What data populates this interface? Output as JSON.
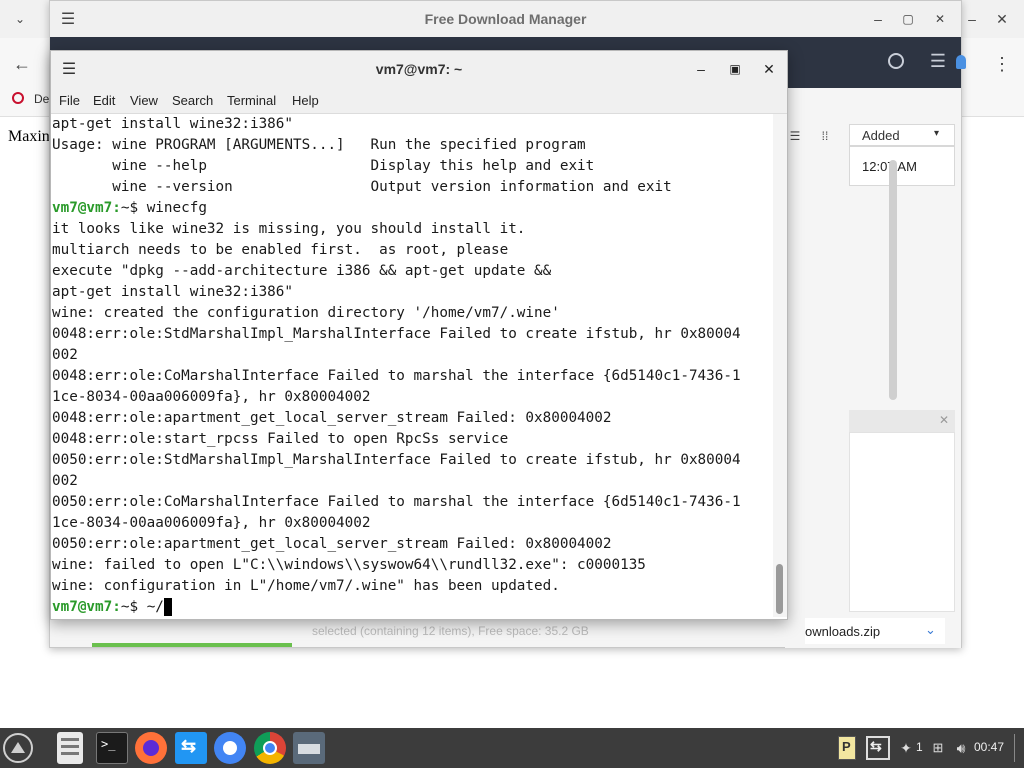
{
  "browser": {
    "bookmark_label": "De",
    "page_text": "Maxin",
    "window_controls": {
      "minimize": "–",
      "maximize": "▫",
      "close": "✕"
    }
  },
  "fdm": {
    "title": "Free Download Manager",
    "column_added": "Added",
    "row_time": "12:07 AM",
    "status_text": "selected (containing 12 items), Free space: 35.2 GB",
    "download_file": "ownloads.zip"
  },
  "terminal": {
    "title": "vm7@vm7: ~",
    "menu": [
      "File",
      "Edit",
      "View",
      "Search",
      "Terminal",
      "Help"
    ],
    "lines": [
      {
        "text": "apt-get install wine32:i386\""
      },
      {
        "text": "Usage: wine PROGRAM [ARGUMENTS...]   Run the specified program"
      },
      {
        "text": "       wine --help                   Display this help and exit"
      },
      {
        "text": "       wine --version                Output version information and exit"
      },
      {
        "prompt": "vm7@vm7:",
        "text": "~$ winecfg"
      },
      {
        "text": "it looks like wine32 is missing, you should install it."
      },
      {
        "text": "multiarch needs to be enabled first.  as root, please"
      },
      {
        "text": "execute \"dpkg --add-architecture i386 && apt-get update &&"
      },
      {
        "text": "apt-get install wine32:i386\""
      },
      {
        "text": "wine: created the configuration directory '/home/vm7/.wine'"
      },
      {
        "text": "0048:err:ole:StdMarshalImpl_MarshalInterface Failed to create ifstub, hr 0x80004"
      },
      {
        "text": "002"
      },
      {
        "text": "0048:err:ole:CoMarshalInterface Failed to marshal the interface {6d5140c1-7436-1"
      },
      {
        "text": "1ce-8034-00aa006009fa}, hr 0x80004002"
      },
      {
        "text": "0048:err:ole:apartment_get_local_server_stream Failed: 0x80004002"
      },
      {
        "text": "0048:err:ole:start_rpcss Failed to open RpcSs service"
      },
      {
        "text": "0050:err:ole:StdMarshalImpl_MarshalInterface Failed to create ifstub, hr 0x80004"
      },
      {
        "text": "002"
      },
      {
        "text": "0050:err:ole:CoMarshalInterface Failed to marshal the interface {6d5140c1-7436-1"
      },
      {
        "text": "1ce-8034-00aa006009fa}, hr 0x80004002"
      },
      {
        "text": "0050:err:ole:apartment_get_local_server_stream Failed: 0x80004002"
      },
      {
        "text": "wine: failed to open L\"C:\\\\windows\\\\syswow64\\\\rundll32.exe\": c0000135"
      },
      {
        "text": "wine: configuration in L\"/home/vm7/.wine\" has been updated."
      },
      {
        "prompt": "vm7@vm7:",
        "text": "~$ ~/"
      }
    ]
  },
  "taskbar": {
    "apps": [
      "menu-icon",
      "file-manager-icon",
      "terminal-icon",
      "firefox-icon",
      "fdm-icon",
      "chromium-icon",
      "chrome-icon",
      "scanner-icon"
    ],
    "workspace": "1",
    "clock": "00:47"
  },
  "colors": {
    "prompt": "#2a9a2a",
    "taskbar": "#3c3c3c",
    "fdm_toolbar": "#2d3442"
  }
}
